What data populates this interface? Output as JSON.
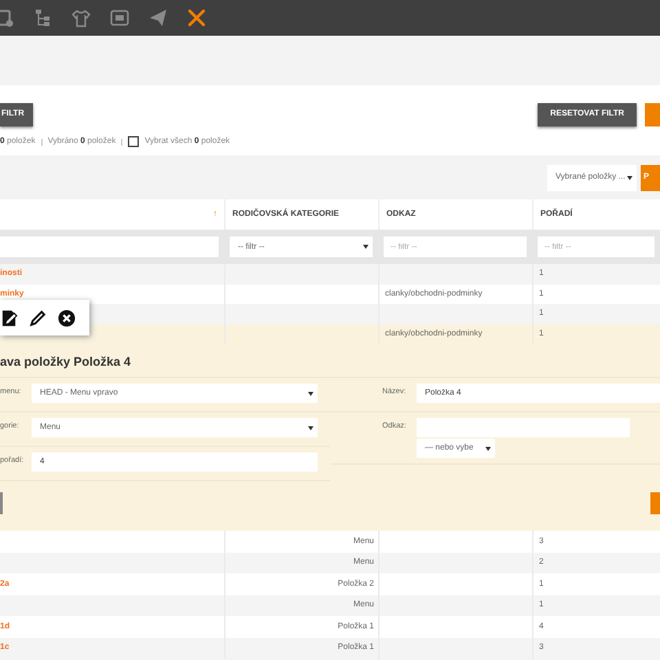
{
  "nav_icons": [
    {
      "kind": "calendar",
      "selected": false
    },
    {
      "kind": "tree",
      "selected": false
    },
    {
      "kind": "shirt",
      "selected": false
    },
    {
      "kind": "card",
      "selected": false
    },
    {
      "kind": "plane",
      "selected": false
    },
    {
      "kind": "tools",
      "selected": true
    }
  ],
  "filter": {
    "apply": "FILTR",
    "reset": "RESETOVAT FILTR"
  },
  "counts": {
    "total": "**0** položek",
    "selected": "Vybráno **0** položek",
    "select_all": {
      "label": "Vybrat všech **0** položek",
      "checked": false
    }
  },
  "bulk": {
    "select": "Vybrané položky ...",
    "button": "P"
  },
  "table": {
    "columns": [
      {
        "label": "↑",
        "kind": "sort"
      },
      {
        "label": "RODIČOVSKÁ KATEGORIE",
        "kind": "text"
      },
      {
        "label": "ODKAZ",
        "kind": "text"
      },
      {
        "label": "POŘADÍ",
        "kind": "text"
      }
    ],
    "filters": [
      {
        "kind": "input"
      },
      {
        "kind": "select",
        "placeholder": "-- filtr --"
      },
      {
        "kind": "input",
        "placeholder": "-- filtr --"
      },
      {
        "kind": "input",
        "placeholder": "-- filtr --"
      }
    ],
    "rows": [
      {
        "name": "inosti",
        "order": "1",
        "highlighted": false
      },
      {
        "name": "minky",
        "link": "clanky/obchodni-podminky",
        "order": "1",
        "highlighted": false
      },
      {
        "order": "1",
        "highlighted": false
      },
      {
        "link": "clanky/obchodni-podminky",
        "order": "1",
        "highlighted": true
      }
    ]
  },
  "edit": {
    "title": "ava položky Položka 4",
    "left": [
      {
        "label": "menu:",
        "kind": "select",
        "value": "HEAD - Menu vpravo"
      },
      {
        "label": "gorie:",
        "kind": "select",
        "value": "Menu"
      },
      {
        "label": "pořadí:",
        "kind": "input",
        "value": "4"
      }
    ],
    "right": [
      {
        "label": "Název:",
        "kind": "input",
        "value": "Položka 4"
      },
      {
        "label": "Odkaz:",
        "kind": "input_select",
        "select": "— nebo vybe"
      }
    ]
  },
  "lower_rows": [
    {
      "parent": "Menu",
      "order": "3"
    },
    {
      "parent": "Menu",
      "order": "2"
    },
    {
      "name": "2a",
      "parent": "Položka 2",
      "order": "1"
    },
    {
      "parent": "Menu",
      "order": "1"
    },
    {
      "name": "1d",
      "parent": "Položka 1",
      "order": "4"
    },
    {
      "name": "1c",
      "parent": "Položka 1",
      "order": "3"
    }
  ]
}
